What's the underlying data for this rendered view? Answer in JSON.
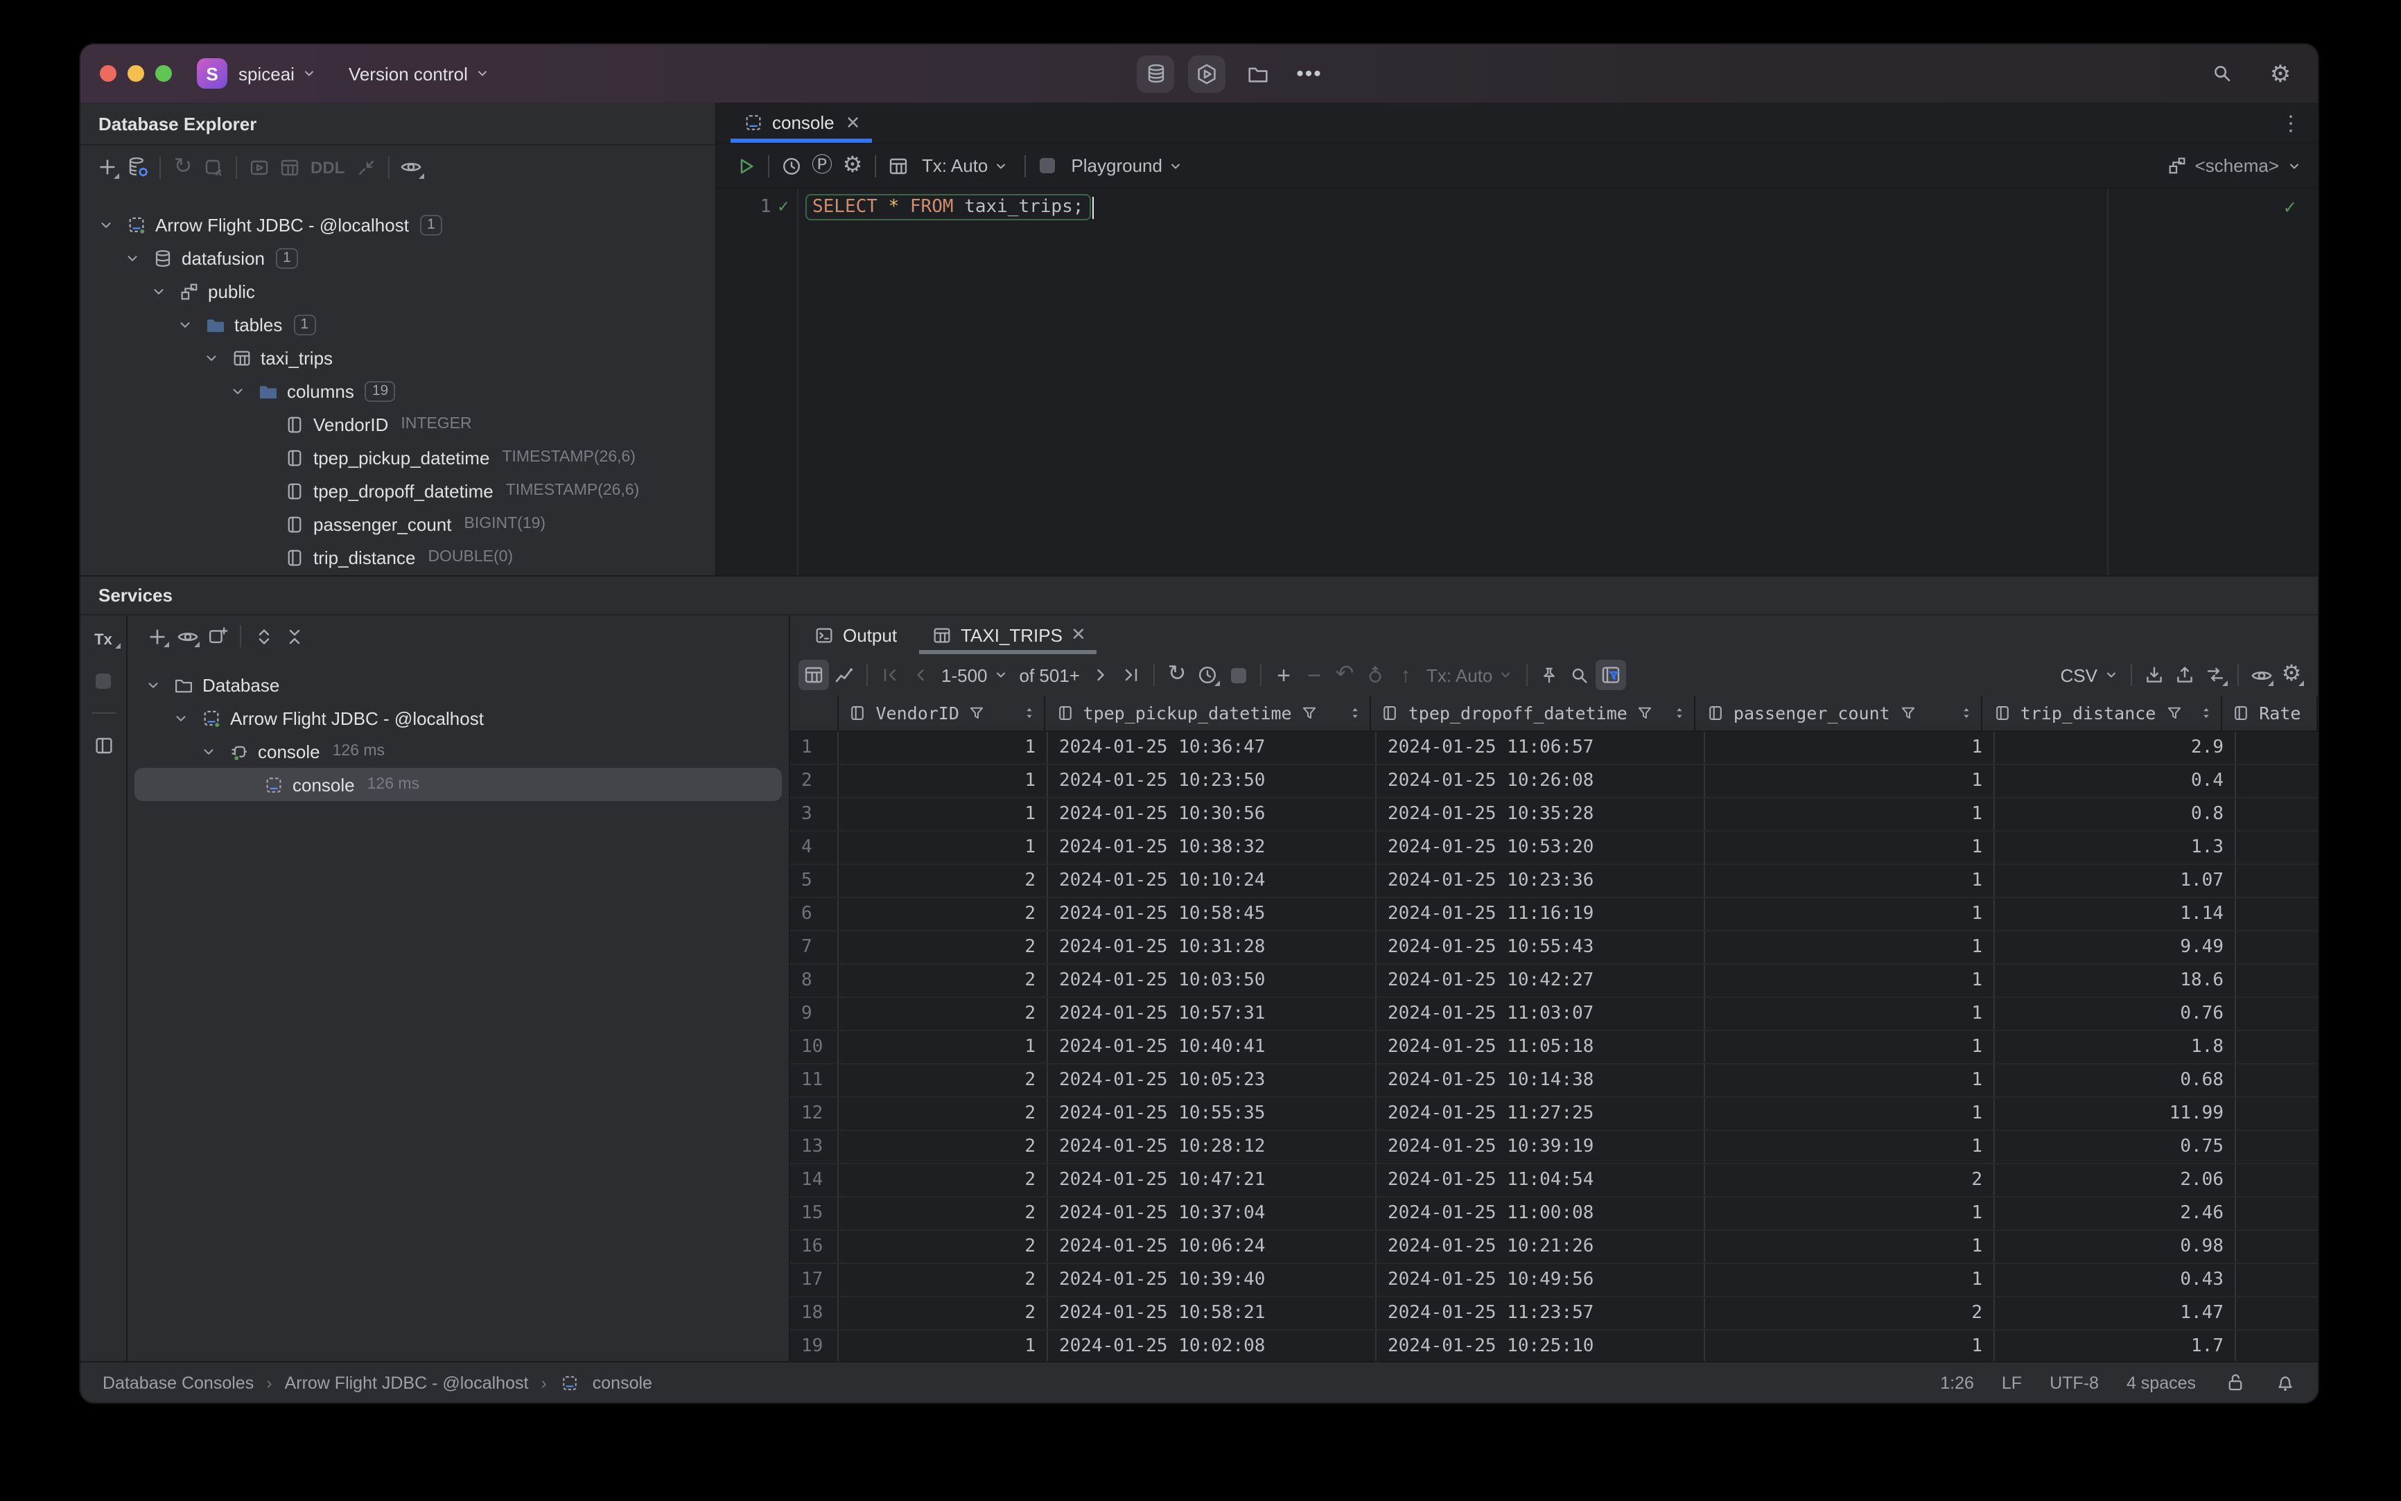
{
  "titlebar": {
    "app_badge": "S",
    "project": "spiceai",
    "version_control": "Version control"
  },
  "database_explorer": {
    "title": "Database Explorer",
    "toolbar": {
      "ddl_label": "DDL"
    },
    "tree": [
      {
        "label": "Arrow Flight JDBC - @localhost",
        "badge": "1",
        "icon": "db-connection",
        "level": 0,
        "chevron": true
      },
      {
        "label": "datafusion",
        "badge": "1",
        "icon": "database",
        "level": 1,
        "chevron": true
      },
      {
        "label": "public",
        "icon": "schema",
        "level": 2,
        "chevron": true
      },
      {
        "label": "tables",
        "badge": "1",
        "icon": "folder",
        "level": 3,
        "chevron": true
      },
      {
        "label": "taxi_trips",
        "icon": "table",
        "level": 4,
        "chevron": true
      },
      {
        "label": "columns",
        "badge": "19",
        "icon": "folder",
        "level": 5,
        "chevron": true
      },
      {
        "label": "VendorID",
        "meta": "INTEGER",
        "icon": "column",
        "level": 6
      },
      {
        "label": "tpep_pickup_datetime",
        "meta": "TIMESTAMP(26,6)",
        "icon": "column",
        "level": 6
      },
      {
        "label": "tpep_dropoff_datetime",
        "meta": "TIMESTAMP(26,6)",
        "icon": "column",
        "level": 6
      },
      {
        "label": "passenger_count",
        "meta": "BIGINT(19)",
        "icon": "column",
        "level": 6
      },
      {
        "label": "trip_distance",
        "meta": "DOUBLE(0)",
        "icon": "column",
        "level": 6
      }
    ]
  },
  "editor": {
    "tab_label": "console",
    "toolbar": {
      "tx": "Tx: Auto",
      "playground": "Playground",
      "schema": "<schema>"
    },
    "line_number": "1",
    "sql": {
      "kw1": "SELECT",
      "star": "*",
      "kw2": "FROM",
      "ident": "taxi_trips",
      "semi": ";"
    }
  },
  "services": {
    "title": "Services",
    "side_tx": "Tx",
    "tree": [
      {
        "label": "Database",
        "icon": "folder-plain",
        "level": 0,
        "chevron": true
      },
      {
        "label": "Arrow Flight JDBC - @localhost",
        "icon": "db-connection",
        "level": 1,
        "chevron": true
      },
      {
        "label": "console",
        "meta": "126 ms",
        "icon": "plug",
        "level": 2,
        "chevron": true
      },
      {
        "label": "console",
        "meta": "126 ms",
        "icon": "console",
        "level": 3,
        "selected": true
      }
    ]
  },
  "results": {
    "tabs": {
      "output": "Output",
      "taxi": "TAXI_TRIPS"
    },
    "toolbar": {
      "page_range": "1-500",
      "page_of": "of 501+",
      "tx": "Tx: Auto",
      "format": "CSV"
    },
    "grid": {
      "columns": [
        "VendorID",
        "tpep_pickup_datetime",
        "tpep_dropoff_datetime",
        "passenger_count",
        "trip_distance",
        "Rate"
      ],
      "rows": [
        [
          "1",
          "1",
          "2024-01-25 10:36:47",
          "2024-01-25 11:06:57",
          "1",
          "2.9"
        ],
        [
          "2",
          "1",
          "2024-01-25 10:23:50",
          "2024-01-25 10:26:08",
          "1",
          "0.4"
        ],
        [
          "3",
          "1",
          "2024-01-25 10:30:56",
          "2024-01-25 10:35:28",
          "1",
          "0.8"
        ],
        [
          "4",
          "1",
          "2024-01-25 10:38:32",
          "2024-01-25 10:53:20",
          "1",
          "1.3"
        ],
        [
          "5",
          "2",
          "2024-01-25 10:10:24",
          "2024-01-25 10:23:36",
          "1",
          "1.07"
        ],
        [
          "6",
          "2",
          "2024-01-25 10:58:45",
          "2024-01-25 11:16:19",
          "1",
          "1.14"
        ],
        [
          "7",
          "2",
          "2024-01-25 10:31:28",
          "2024-01-25 10:55:43",
          "1",
          "9.49"
        ],
        [
          "8",
          "2",
          "2024-01-25 10:03:50",
          "2024-01-25 10:42:27",
          "1",
          "18.6"
        ],
        [
          "9",
          "2",
          "2024-01-25 10:57:31",
          "2024-01-25 11:03:07",
          "1",
          "0.76"
        ],
        [
          "10",
          "1",
          "2024-01-25 10:40:41",
          "2024-01-25 11:05:18",
          "1",
          "1.8"
        ],
        [
          "11",
          "2",
          "2024-01-25 10:05:23",
          "2024-01-25 10:14:38",
          "1",
          "0.68"
        ],
        [
          "12",
          "2",
          "2024-01-25 10:55:35",
          "2024-01-25 11:27:25",
          "1",
          "11.99"
        ],
        [
          "13",
          "2",
          "2024-01-25 10:28:12",
          "2024-01-25 10:39:19",
          "1",
          "0.75"
        ],
        [
          "14",
          "2",
          "2024-01-25 10:47:21",
          "2024-01-25 11:04:54",
          "2",
          "2.06"
        ],
        [
          "15",
          "2",
          "2024-01-25 10:37:04",
          "2024-01-25 11:00:08",
          "1",
          "2.46"
        ],
        [
          "16",
          "2",
          "2024-01-25 10:06:24",
          "2024-01-25 10:21:26",
          "1",
          "0.98"
        ],
        [
          "17",
          "2",
          "2024-01-25 10:39:40",
          "2024-01-25 10:49:56",
          "1",
          "0.43"
        ],
        [
          "18",
          "2",
          "2024-01-25 10:58:21",
          "2024-01-25 11:23:57",
          "2",
          "1.47"
        ],
        [
          "19",
          "1",
          "2024-01-25 10:02:08",
          "2024-01-25 10:25:10",
          "1",
          "1.7"
        ]
      ]
    }
  },
  "statusbar": {
    "crumb1": "Database Consoles",
    "crumb2": "Arrow Flight JDBC - @localhost",
    "crumb3": "console",
    "caret": "1:26",
    "line_ending": "LF",
    "encoding": "UTF-8",
    "indent": "4 spaces"
  },
  "colors": {
    "accent_blue": "#3574F0",
    "run_green": "#57965C",
    "sql_keyword": "#CF8E6D",
    "sql_star": "#E8BF6A",
    "selected_row": "#43454A",
    "editor_bg": "#1E1F22",
    "panel_bg": "#2B2D30"
  }
}
